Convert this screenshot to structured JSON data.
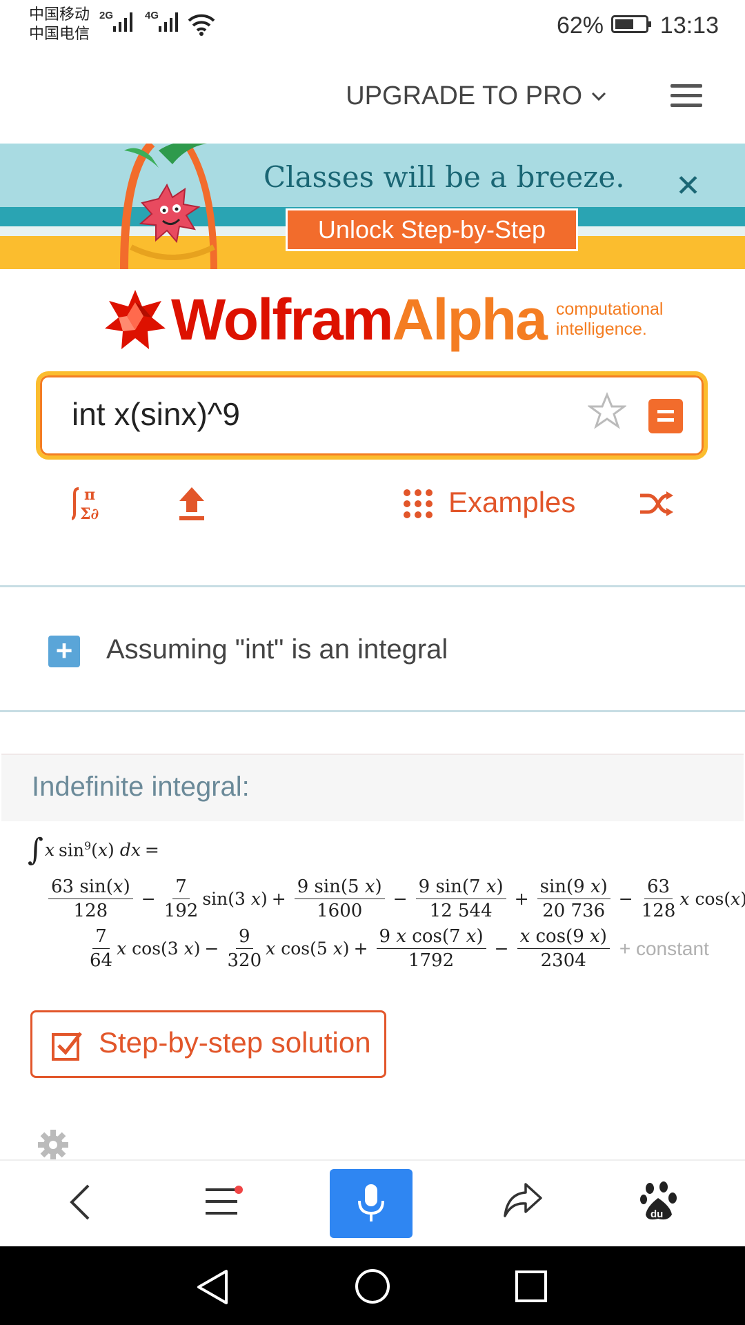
{
  "status_bar": {
    "carrier1": "中国移动",
    "carrier2": "中国电信",
    "net1": "2G",
    "net2": "4G",
    "battery": "62%",
    "battery_level": 0.62,
    "time": "13:13"
  },
  "header": {
    "upgrade_label": "UPGRADE TO PRO",
    "menu_icon": "hamburger-menu-icon"
  },
  "banner": {
    "headline": "Classes will be a breeze.",
    "cta": "Unlock Step-by-Step",
    "close_icon": "close-icon"
  },
  "logo": {
    "wolfram": "Wolfram",
    "alpha": "Alpha",
    "tagline1": "computational",
    "tagline2": "intelligence."
  },
  "search": {
    "value": "int x(sinx)^9",
    "favorite_icon": "star-icon",
    "submit_icon": "equals-icon"
  },
  "toolbar": {
    "math_input_icon": "math-input-icon",
    "upload_icon": "upload-icon",
    "examples_label": "Examples",
    "random_icon": "shuffle-icon"
  },
  "assumption": {
    "text": "Assuming \"int\" is an integral"
  },
  "result": {
    "pod_title": "Indefinite integral:",
    "lhs": "∫ x sin⁹(x) dx =",
    "constant": "+ constant",
    "step_button": "Step-by-step solution"
  },
  "browser_bar": {
    "back_icon": "back-arrow-icon",
    "menu_icon": "menu-icon",
    "mic_icon": "microphone-icon",
    "share_icon": "share-icon",
    "baidu_icon": "baidu-paw-icon"
  },
  "colors": {
    "accent_orange": "#e2562a",
    "wolfram_red": "#dd1100",
    "alpha_orange": "#f47d22",
    "banner_teal": "#2aa4b3",
    "banner_yellow": "#fbbd2e",
    "mic_blue": "#2f86f2"
  }
}
